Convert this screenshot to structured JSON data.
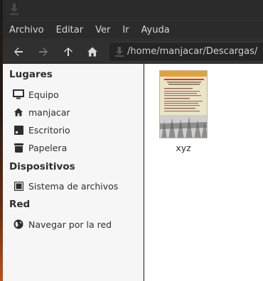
{
  "menubar": {
    "items": [
      "Archivo",
      "Editar",
      "Ver",
      "Ir",
      "Ayuda"
    ]
  },
  "location": {
    "path": "/home/manjacar/Descargas/"
  },
  "sidebar": {
    "sections": [
      {
        "title": "Lugares"
      },
      {
        "title": "Dispositivos"
      },
      {
        "title": "Red"
      }
    ],
    "items": [
      {
        "label": "Equipo",
        "icon": "monitor-icon"
      },
      {
        "label": "manjacar",
        "icon": "home-icon"
      },
      {
        "label": "Escritorio",
        "icon": "desktop-icon"
      },
      {
        "label": "Papelera",
        "icon": "trash-icon"
      },
      {
        "label": "Sistema de archivos",
        "icon": "drive-icon"
      },
      {
        "label": "Navegar por la red",
        "icon": "network-icon"
      }
    ]
  },
  "files": [
    {
      "name": "xyz",
      "thumb_title": "CHARLA - COLOQUIO",
      "thumb_subtitle": "La verdadera España que tanto nos ocultan"
    }
  ],
  "colors": {
    "sidebar_bg": "#f6f6f6",
    "toolbar_bg": "#303030",
    "content_bg": "#ffffff"
  }
}
